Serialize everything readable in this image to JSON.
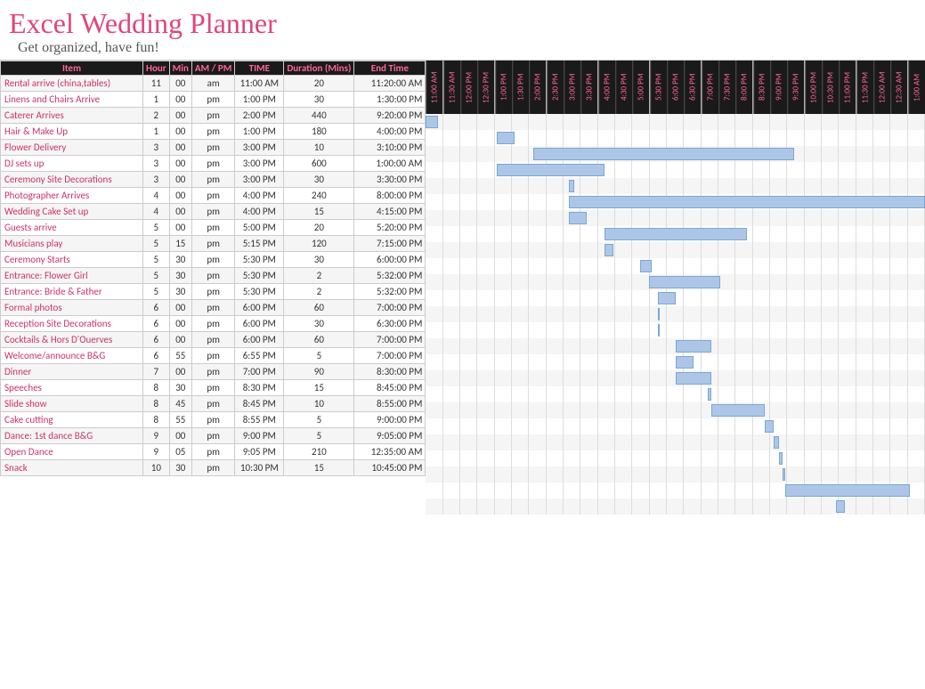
{
  "app": {
    "title": "Excel Wedding Planner",
    "subtitle": "Get organized, have fun!"
  },
  "table": {
    "headers": {
      "item": "Item",
      "hour": "Hour",
      "min": "Min",
      "ampm": "AM / PM",
      "time": "TIME",
      "duration": "Duration (Mins)",
      "endtime": "End Time"
    },
    "rows": [
      {
        "item": "Rental arrive (china,tables)",
        "hour": "11",
        "min": "00",
        "ampm": "am",
        "time": "11:00 AM",
        "dur": "20",
        "end": "11:20:00 AM"
      },
      {
        "item": "Linens and Chairs Arrive",
        "hour": "1",
        "min": "00",
        "ampm": "pm",
        "time": "1:00 PM",
        "dur": "30",
        "end": "1:30:00 PM"
      },
      {
        "item": "Caterer Arrives",
        "hour": "2",
        "min": "00",
        "ampm": "pm",
        "time": "2:00 PM",
        "dur": "440",
        "end": "9:20:00 PM"
      },
      {
        "item": "Hair & Make Up",
        "hour": "1",
        "min": "00",
        "ampm": "pm",
        "time": "1:00 PM",
        "dur": "180",
        "end": "4:00:00 PM"
      },
      {
        "item": "Flower Delivery",
        "hour": "3",
        "min": "00",
        "ampm": "pm",
        "time": "3:00 PM",
        "dur": "10",
        "end": "3:10:00 PM"
      },
      {
        "item": "DJ sets up",
        "hour": "3",
        "min": "00",
        "ampm": "pm",
        "time": "3:00 PM",
        "dur": "600",
        "end": "1:00:00 AM"
      },
      {
        "item": "Ceremony Site Decorations",
        "hour": "3",
        "min": "00",
        "ampm": "pm",
        "time": "3:00 PM",
        "dur": "30",
        "end": "3:30:00 PM"
      },
      {
        "item": "Photographer Arrives",
        "hour": "4",
        "min": "00",
        "ampm": "pm",
        "time": "4:00 PM",
        "dur": "240",
        "end": "8:00:00 PM"
      },
      {
        "item": "Wedding Cake Set up",
        "hour": "4",
        "min": "00",
        "ampm": "pm",
        "time": "4:00 PM",
        "dur": "15",
        "end": "4:15:00 PM"
      },
      {
        "item": "Guests arrive",
        "hour": "5",
        "min": "00",
        "ampm": "pm",
        "time": "5:00 PM",
        "dur": "20",
        "end": "5:20:00 PM"
      },
      {
        "item": "Musicians play",
        "hour": "5",
        "min": "15",
        "ampm": "pm",
        "time": "5:15 PM",
        "dur": "120",
        "end": "7:15:00 PM"
      },
      {
        "item": "Ceremony Starts",
        "hour": "5",
        "min": "30",
        "ampm": "pm",
        "time": "5:30 PM",
        "dur": "30",
        "end": "6:00:00 PM"
      },
      {
        "item": "Entrance: Flower Girl",
        "hour": "5",
        "min": "30",
        "ampm": "pm",
        "time": "5:30 PM",
        "dur": "2",
        "end": "5:32:00 PM"
      },
      {
        "item": "Entrance: Bride & Father",
        "hour": "5",
        "min": "30",
        "ampm": "pm",
        "time": "5:30 PM",
        "dur": "2",
        "end": "5:32:00 PM"
      },
      {
        "item": "Formal photos",
        "hour": "6",
        "min": "00",
        "ampm": "pm",
        "time": "6:00 PM",
        "dur": "60",
        "end": "7:00:00 PM"
      },
      {
        "item": "Reception Site Decorations",
        "hour": "6",
        "min": "00",
        "ampm": "pm",
        "time": "6:00 PM",
        "dur": "30",
        "end": "6:30:00 PM"
      },
      {
        "item": "Cocktails & Hors D'Ouerves",
        "hour": "6",
        "min": "00",
        "ampm": "pm",
        "time": "6:00 PM",
        "dur": "60",
        "end": "7:00:00 PM"
      },
      {
        "item": "Welcome/announce B&G",
        "hour": "6",
        "min": "55",
        "ampm": "pm",
        "time": "6:55 PM",
        "dur": "5",
        "end": "7:00:00 PM"
      },
      {
        "item": "Dinner",
        "hour": "7",
        "min": "00",
        "ampm": "pm",
        "time": "7:00 PM",
        "dur": "90",
        "end": "8:30:00 PM"
      },
      {
        "item": "Speeches",
        "hour": "8",
        "min": "30",
        "ampm": "pm",
        "time": "8:30 PM",
        "dur": "15",
        "end": "8:45:00 PM"
      },
      {
        "item": "Slide show",
        "hour": "8",
        "min": "45",
        "ampm": "pm",
        "time": "8:45 PM",
        "dur": "10",
        "end": "8:55:00 PM"
      },
      {
        "item": "Cake cutting",
        "hour": "8",
        "min": "55",
        "ampm": "pm",
        "time": "8:55 PM",
        "dur": "5",
        "end": "9:00:00 PM"
      },
      {
        "item": "Dance: 1st dance B&G",
        "hour": "9",
        "min": "00",
        "ampm": "pm",
        "time": "9:00 PM",
        "dur": "5",
        "end": "9:05:00 PM"
      },
      {
        "item": "Open Dance",
        "hour": "9",
        "min": "05",
        "ampm": "pm",
        "time": "9:05 PM",
        "dur": "210",
        "end": "12:35:00 AM"
      },
      {
        "item": "Snack",
        "hour": "10",
        "min": "30",
        "ampm": "pm",
        "time": "10:30 PM",
        "dur": "15",
        "end": "10:45:00 PM"
      }
    ]
  },
  "gantt": {
    "time_labels": [
      "11:00 AM",
      "11:30 AM",
      "12:00 PM",
      "12:30 PM",
      "1:00 PM",
      "1:30 PM",
      "2:00 PM",
      "2:30 PM",
      "3:00 PM",
      "3:30 PM",
      "4:00 PM",
      "4:30 PM",
      "5:00 PM",
      "5:30 PM",
      "6:00 PM",
      "6:30 PM",
      "7:00 PM",
      "7:30 PM",
      "8:00 PM",
      "8:30 PM",
      "9:00 PM",
      "9:30 PM",
      "10:00 PM",
      "10:30 PM",
      "11:00 PM",
      "11:30 PM",
      "12:00 AM",
      "12:30 AM",
      "1:00 AM"
    ]
  }
}
